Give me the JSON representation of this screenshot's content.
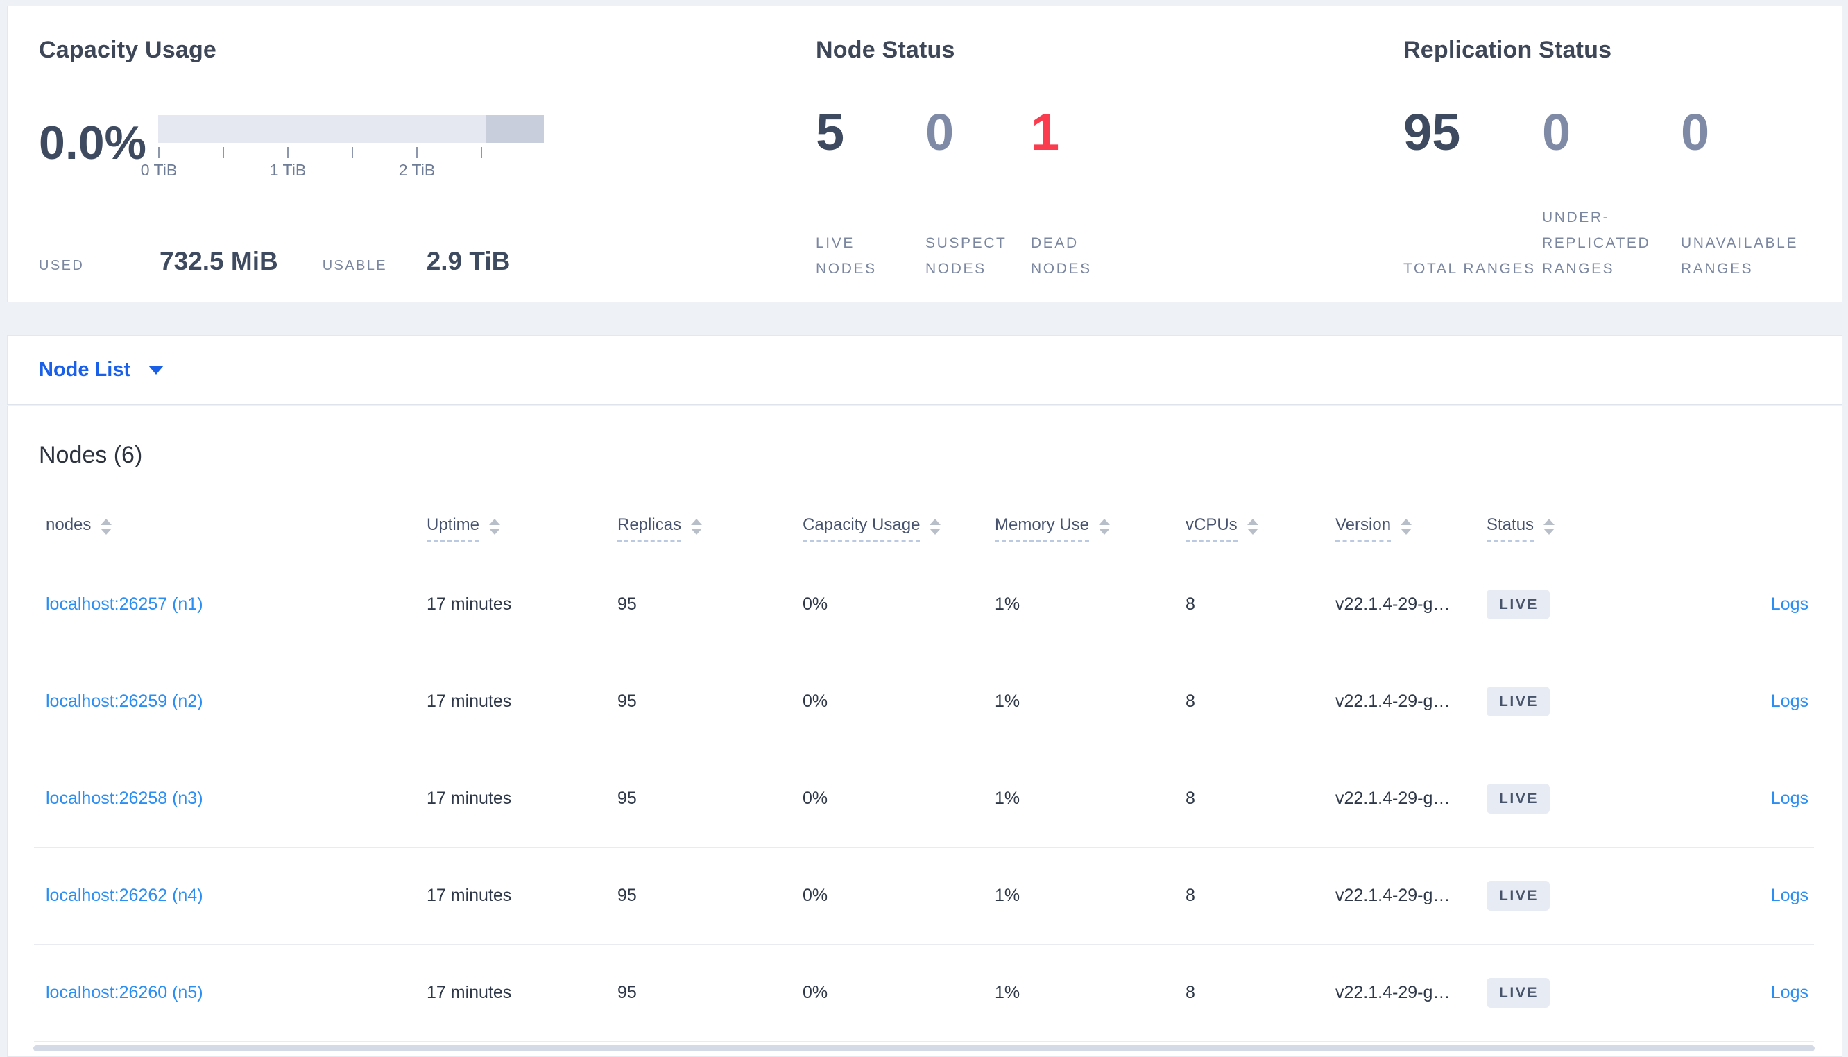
{
  "panels": {
    "capacity": {
      "title": "Capacity Usage",
      "percent": "0.0%",
      "ticks": [
        "0 TiB",
        "1 TiB",
        "2 TiB"
      ],
      "used_label": "USED",
      "used_value": "732.5 MiB",
      "usable_label": "USABLE",
      "usable_value": "2.9 TiB"
    },
    "node_status": {
      "title": "Node Status",
      "stats": [
        {
          "value": "5",
          "label": "LIVE NODES"
        },
        {
          "value": "0",
          "label": "SUSPECT NODES"
        },
        {
          "value": "1",
          "label": "DEAD NODES"
        }
      ]
    },
    "replication": {
      "title": "Replication Status",
      "stats": [
        {
          "value": "95",
          "label": "TOTAL RANGES"
        },
        {
          "value": "0",
          "label": "UNDER-REPLICATED RANGES"
        },
        {
          "value": "0",
          "label": "UNAVAILABLE RANGES"
        }
      ]
    }
  },
  "view_selector": {
    "label": "Node List",
    "icon": "caret-down-icon"
  },
  "table": {
    "title": "Nodes (6)",
    "columns": [
      "nodes",
      "Uptime",
      "Replicas",
      "Capacity Usage",
      "Memory Use",
      "vCPUs",
      "Version",
      "Status"
    ],
    "rows": [
      {
        "node": "localhost:26257 (n1)",
        "uptime": "17 minutes",
        "replicas": "95",
        "capacity": "0%",
        "memory": "1%",
        "vcpus": "8",
        "version": "v22.1.4-29-g…",
        "status": "LIVE",
        "logs": "Logs"
      },
      {
        "node": "localhost:26259 (n2)",
        "uptime": "17 minutes",
        "replicas": "95",
        "capacity": "0%",
        "memory": "1%",
        "vcpus": "8",
        "version": "v22.1.4-29-g…",
        "status": "LIVE",
        "logs": "Logs"
      },
      {
        "node": "localhost:26258 (n3)",
        "uptime": "17 minutes",
        "replicas": "95",
        "capacity": "0%",
        "memory": "1%",
        "vcpus": "8",
        "version": "v22.1.4-29-g…",
        "status": "LIVE",
        "logs": "Logs"
      },
      {
        "node": "localhost:26262 (n4)",
        "uptime": "17 minutes",
        "replicas": "95",
        "capacity": "0%",
        "memory": "1%",
        "vcpus": "8",
        "version": "v22.1.4-29-g…",
        "status": "LIVE",
        "logs": "Logs"
      },
      {
        "node": "localhost:26260 (n5)",
        "uptime": "17 minutes",
        "replicas": "95",
        "capacity": "0%",
        "memory": "1%",
        "vcpus": "8",
        "version": "v22.1.4-29-g…",
        "status": "LIVE",
        "logs": "Logs"
      }
    ]
  },
  "colors": {
    "link_blue": "#2a8ef2",
    "selector_blue": "#1a5fe8",
    "danger_red": "#fb3c4e",
    "dark_slate": "#3e4a5f",
    "muted_slate": "#7e8aa6",
    "badge_bg": "#e7ebf3",
    "bar_light": "#e5e8f1",
    "bar_dark": "#c9cedc"
  }
}
